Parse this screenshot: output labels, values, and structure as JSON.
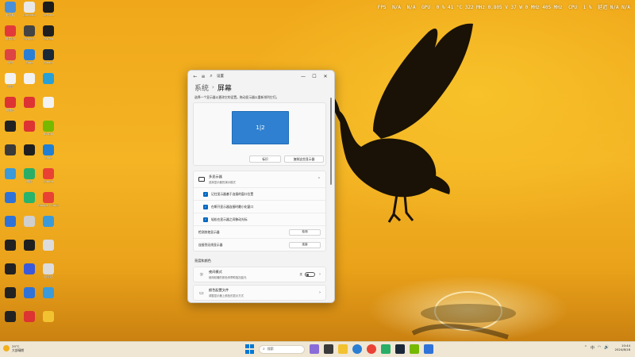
{
  "perf": {
    "fps_label": "FPS",
    "fps_value": "N/A",
    "fps_extra": "N/A",
    "gpu_label": "GPU",
    "gpu_values": "0 %  41 °C  322 MHz  0.805 V  37 W  0 MHz  405 MHz",
    "cpu_label": "CPU",
    "cpu_value": "1 %",
    "extra": "延迟 N/A  N/A"
  },
  "desktop_icons": [
    {
      "label": "此电脑",
      "color": "#4a90d9"
    },
    {
      "label": "Bandizip",
      "color": "#e8e8e8"
    },
    {
      "label": "GeForce",
      "color": "#1c1c1c"
    },
    {
      "label": "网易UU",
      "color": "#e23a3a"
    },
    {
      "label": "Ryujinx",
      "color": "#444"
    },
    {
      "label": "TapTap",
      "color": "#1f1f1f"
    },
    {
      "label": "WPS",
      "color": "#d44"
    },
    {
      "label": "Edge",
      "color": "#2a7fd4"
    },
    {
      "label": "Steam",
      "color": "#1b2838"
    },
    {
      "label": "文档",
      "color": "#f2f2f2"
    },
    {
      "label": "",
      "color": "#f2f2f2"
    },
    {
      "label": "",
      "color": "#27a0d8"
    },
    {
      "label": "网易云",
      "color": "#d33"
    },
    {
      "label": "",
      "color": "#d33"
    },
    {
      "label": "",
      "color": "#f2f2f2"
    },
    {
      "label": "",
      "color": "#222"
    },
    {
      "label": "",
      "color": "#d33"
    },
    {
      "label": "NVIDIA",
      "color": "#76b900"
    },
    {
      "label": "",
      "color": "#3a3a3a"
    },
    {
      "label": "",
      "color": "#1f1f1f"
    },
    {
      "label": "Edge",
      "color": "#1f7fd4"
    },
    {
      "label": "",
      "color": "#3b9ad9"
    },
    {
      "label": "微信",
      "color": "#2aae67"
    },
    {
      "label": "Chrome",
      "color": "#e94235"
    },
    {
      "label": "",
      "color": "#2f73d9"
    },
    {
      "label": "",
      "color": "#28b46c"
    },
    {
      "label": "Google Chrome",
      "color": "#e94235"
    },
    {
      "label": "",
      "color": "#2f73d9"
    },
    {
      "label": "",
      "color": "#cfcfcf"
    },
    {
      "label": "",
      "color": "#3b9ad9"
    },
    {
      "label": "",
      "color": "#222"
    },
    {
      "label": "",
      "color": "#1f1f1f"
    },
    {
      "label": "",
      "color": "#dcdcdc"
    },
    {
      "label": "",
      "color": "#222"
    },
    {
      "label": "",
      "color": "#3a5ad9"
    },
    {
      "label": "回收站",
      "color": "#dcdcdc"
    },
    {
      "label": "",
      "color": "#222"
    },
    {
      "label": "",
      "color": "#2f73d9"
    },
    {
      "label": "",
      "color": "#3b9ad9"
    },
    {
      "label": "",
      "color": "#222"
    },
    {
      "label": "",
      "color": "#d33"
    },
    {
      "label": "",
      "color": "#f2c230"
    }
  ],
  "window": {
    "back_icon": "←",
    "menu_icon": "≡",
    "search_icon": "⌕",
    "title": "设置",
    "breadcrumb_parent": "系统",
    "breadcrumb_sep": "›",
    "breadcrumb_current": "屏幕",
    "minimize": "—",
    "maximize": "☐",
    "close": "✕",
    "hint": "选择一个显示器以更改它的设置。拖动显示器以重新排列它们。",
    "monitor_label": "1|2",
    "identify_button": "标识",
    "detect_button": "复制这些显示器",
    "multi": {
      "title": "多显示器",
      "subtitle": "选择显示器的演示模式",
      "checks": [
        {
          "label": "记住显示器基于连接的窗口位置"
        },
        {
          "label": "在断开显示器连接时最小化窗口"
        },
        {
          "label": "轻松在显示器之间移动光标"
        }
      ],
      "detect_other_label": "检测其他显示器",
      "detect_other_button": "检测",
      "wireless_label": "连接到无线显示器",
      "wireless_button": "连接"
    },
    "section_title": "亮度和颜色",
    "options": [
      {
        "title": "夜间模式",
        "subtitle": "使用较暖的颜色来帮助阻挡蓝光",
        "toggle_label": "关",
        "icon": "☼"
      },
      {
        "title": "颜色配置文件",
        "subtitle": "调整显示器上颜色的显示方式",
        "icon": "▭"
      }
    ]
  },
  "taskbar": {
    "weather_temp": "29°C",
    "weather_desc": "大部晴朗",
    "search_placeholder": "搜索",
    "search_icon": "⌕",
    "tray_up": "⌃",
    "tray_lang": "中",
    "tray_wifi": "◠",
    "tray_vol": "🔊",
    "time": "10:44",
    "date": "2024/8/18"
  }
}
